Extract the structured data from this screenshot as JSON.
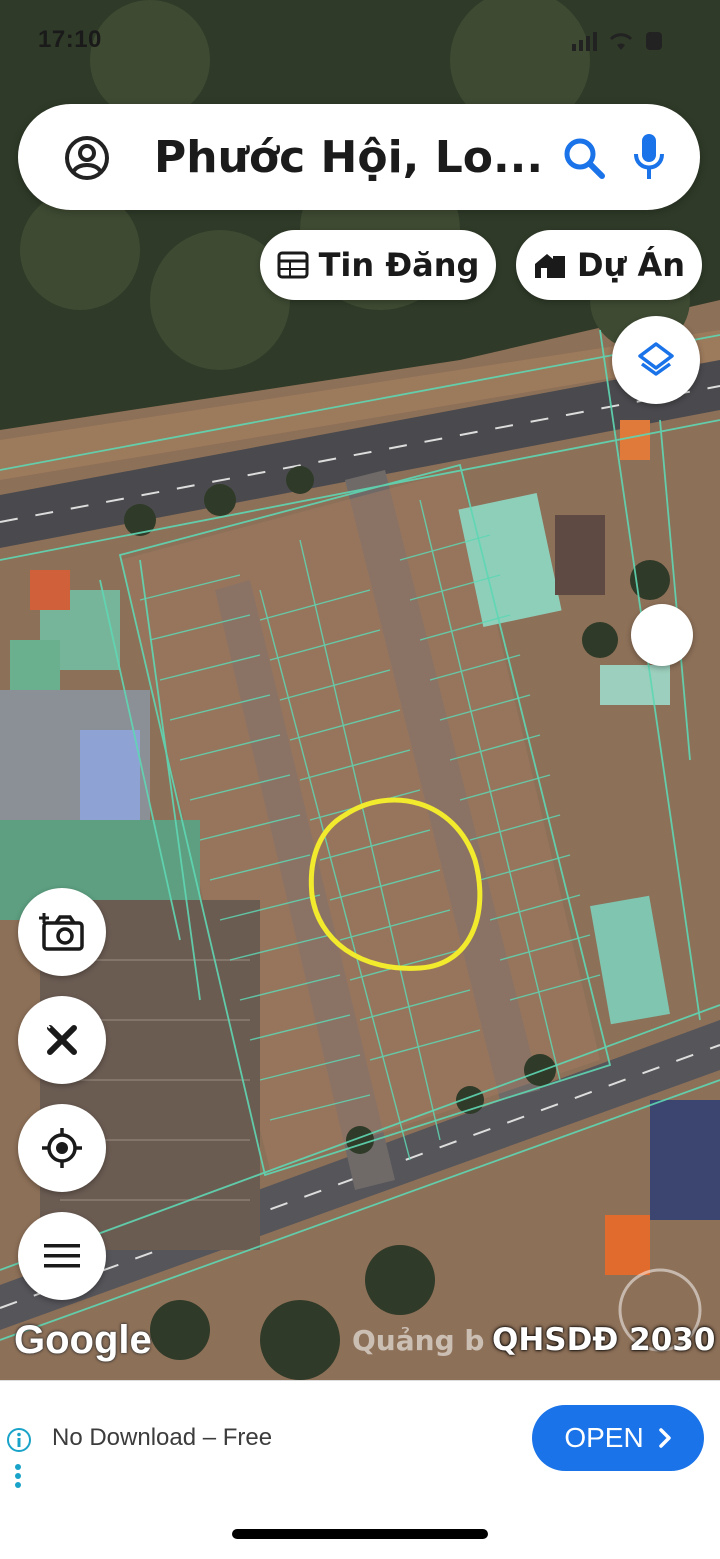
{
  "status_bar": {
    "time": "17:10"
  },
  "search": {
    "text": "Phước Hội, Lo..."
  },
  "chips": {
    "listings_label": "Tin Đăng",
    "projects_label": "Dự Án"
  },
  "map": {
    "attribution": "Google",
    "overlay_text": "Quảng b",
    "planning_label": "QHSDĐ 2030",
    "highlight_color": "#f2ea2c",
    "parcel_line_color": "#5fd7b3"
  },
  "ad": {
    "text": "No Download – Free",
    "button_label": "OPEN"
  }
}
